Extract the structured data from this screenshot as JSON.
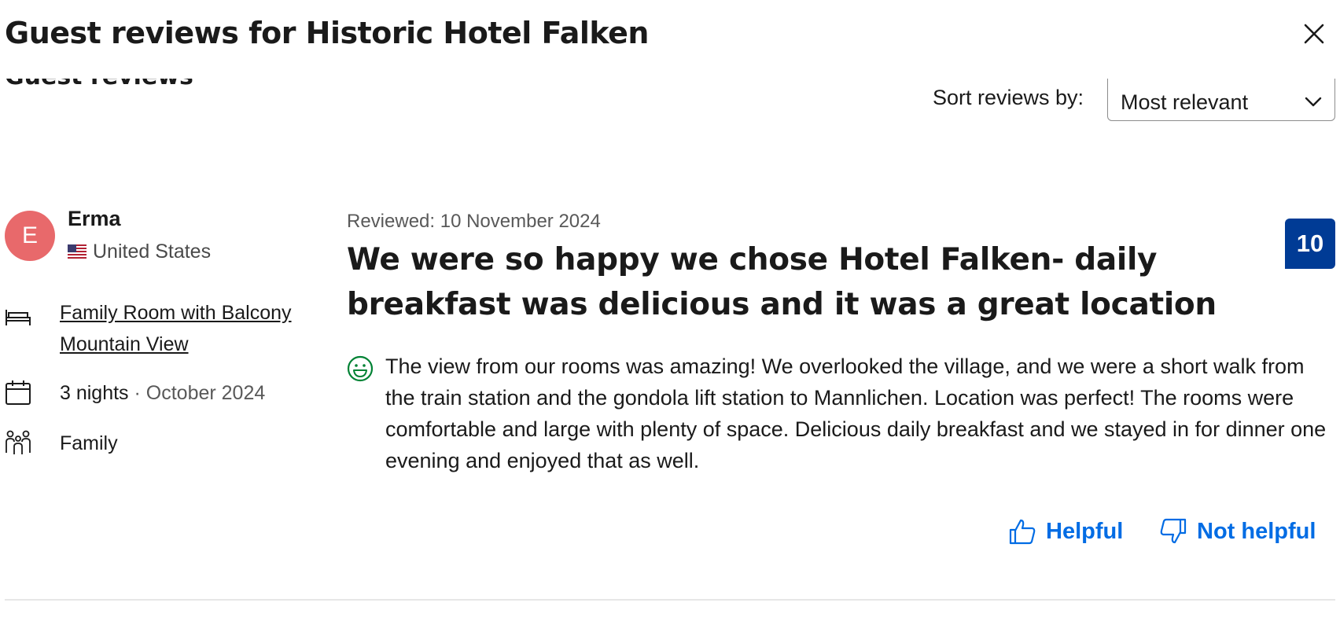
{
  "modal": {
    "title": "Guest reviews for Historic Hotel Falken"
  },
  "section": {
    "heading": "Guest reviews",
    "sort_label": "Sort reviews by:",
    "sort_value": "Most relevant"
  },
  "review": {
    "avatar_initial": "E",
    "reviewer_name": "Erma",
    "country": "United States",
    "room_type": "Family Room with Balcony Mountain View",
    "stay_nights": "3 nights",
    "stay_separator": " · ",
    "stay_month": "October 2024",
    "traveler_type": "Family",
    "date": "Reviewed: 10 November 2024",
    "title": "We were so happy we chose Hotel Falken- daily breakfast was delicious and it was a great location",
    "score": "10",
    "body": "The view from our rooms was amazing! We overlooked the village, and we were a short walk from the train station and the gondola lift station to Mannlichen. Location was perfect! The rooms were comfortable and large with plenty of space. Delicious daily breakfast and we stayed in for dinner one evening and enjoyed that as well.",
    "helpful_label": "Helpful",
    "not_helpful_label": "Not helpful"
  },
  "colors": {
    "avatar_bg": "#e8696b",
    "score_bg": "#003b95",
    "link_blue": "#006ce4",
    "positive_green": "#008234"
  },
  "icons": {
    "close": "close-icon",
    "chevron": "chevron-down-icon",
    "flag": "us-flag-icon",
    "bed": "bed-icon",
    "calendar": "calendar-icon",
    "family": "family-icon",
    "smile": "smile-icon",
    "thumbs_up": "thumbs-up-icon",
    "thumbs_down": "thumbs-down-icon"
  }
}
